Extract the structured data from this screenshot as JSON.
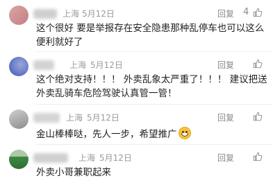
{
  "comments": [
    {
      "location": "上海",
      "date": "5月12日",
      "reply_label": "回复",
      "likes": "4",
      "text": "这个很好 要是举报存在安全隐患那种乱停车也可以这么便利就好了",
      "avatar_colors": [
        "#d9a7a2",
        "#c47d86"
      ],
      "name_color": "#cfcfcf"
    },
    {
      "location": "上海",
      "date": "5月12日",
      "reply_label": "回复",
      "likes": "",
      "text": "这个绝对支持！！！ 外卖乱象太严重了！！！ 建议把送外卖乱骑车危险驾驶认真管一管！",
      "avatar_colors": [
        "#3f57b8",
        "#9aa7d9"
      ],
      "name_color": "#d2d2d2"
    },
    {
      "location": "上海",
      "date": "5月12日",
      "reply_label": "回复",
      "likes": "",
      "text": "金山棒棒哒，先人一步，希望推广",
      "emoji": "grinning-face-emoji",
      "avatar_colors": [
        "#b9b9b9",
        "#8c8c8c"
      ],
      "name_color": "#d4d4d4"
    },
    {
      "location": "上海",
      "date": "5月12日",
      "reply_label": "回复",
      "likes": "",
      "text": "外卖小哥兼职起来",
      "avatar_colors": [
        "#3c8a43",
        "#aec8a8"
      ],
      "name_color": "#d0d0d0"
    }
  ],
  "icons": {
    "like": "thumbs-up-icon"
  }
}
